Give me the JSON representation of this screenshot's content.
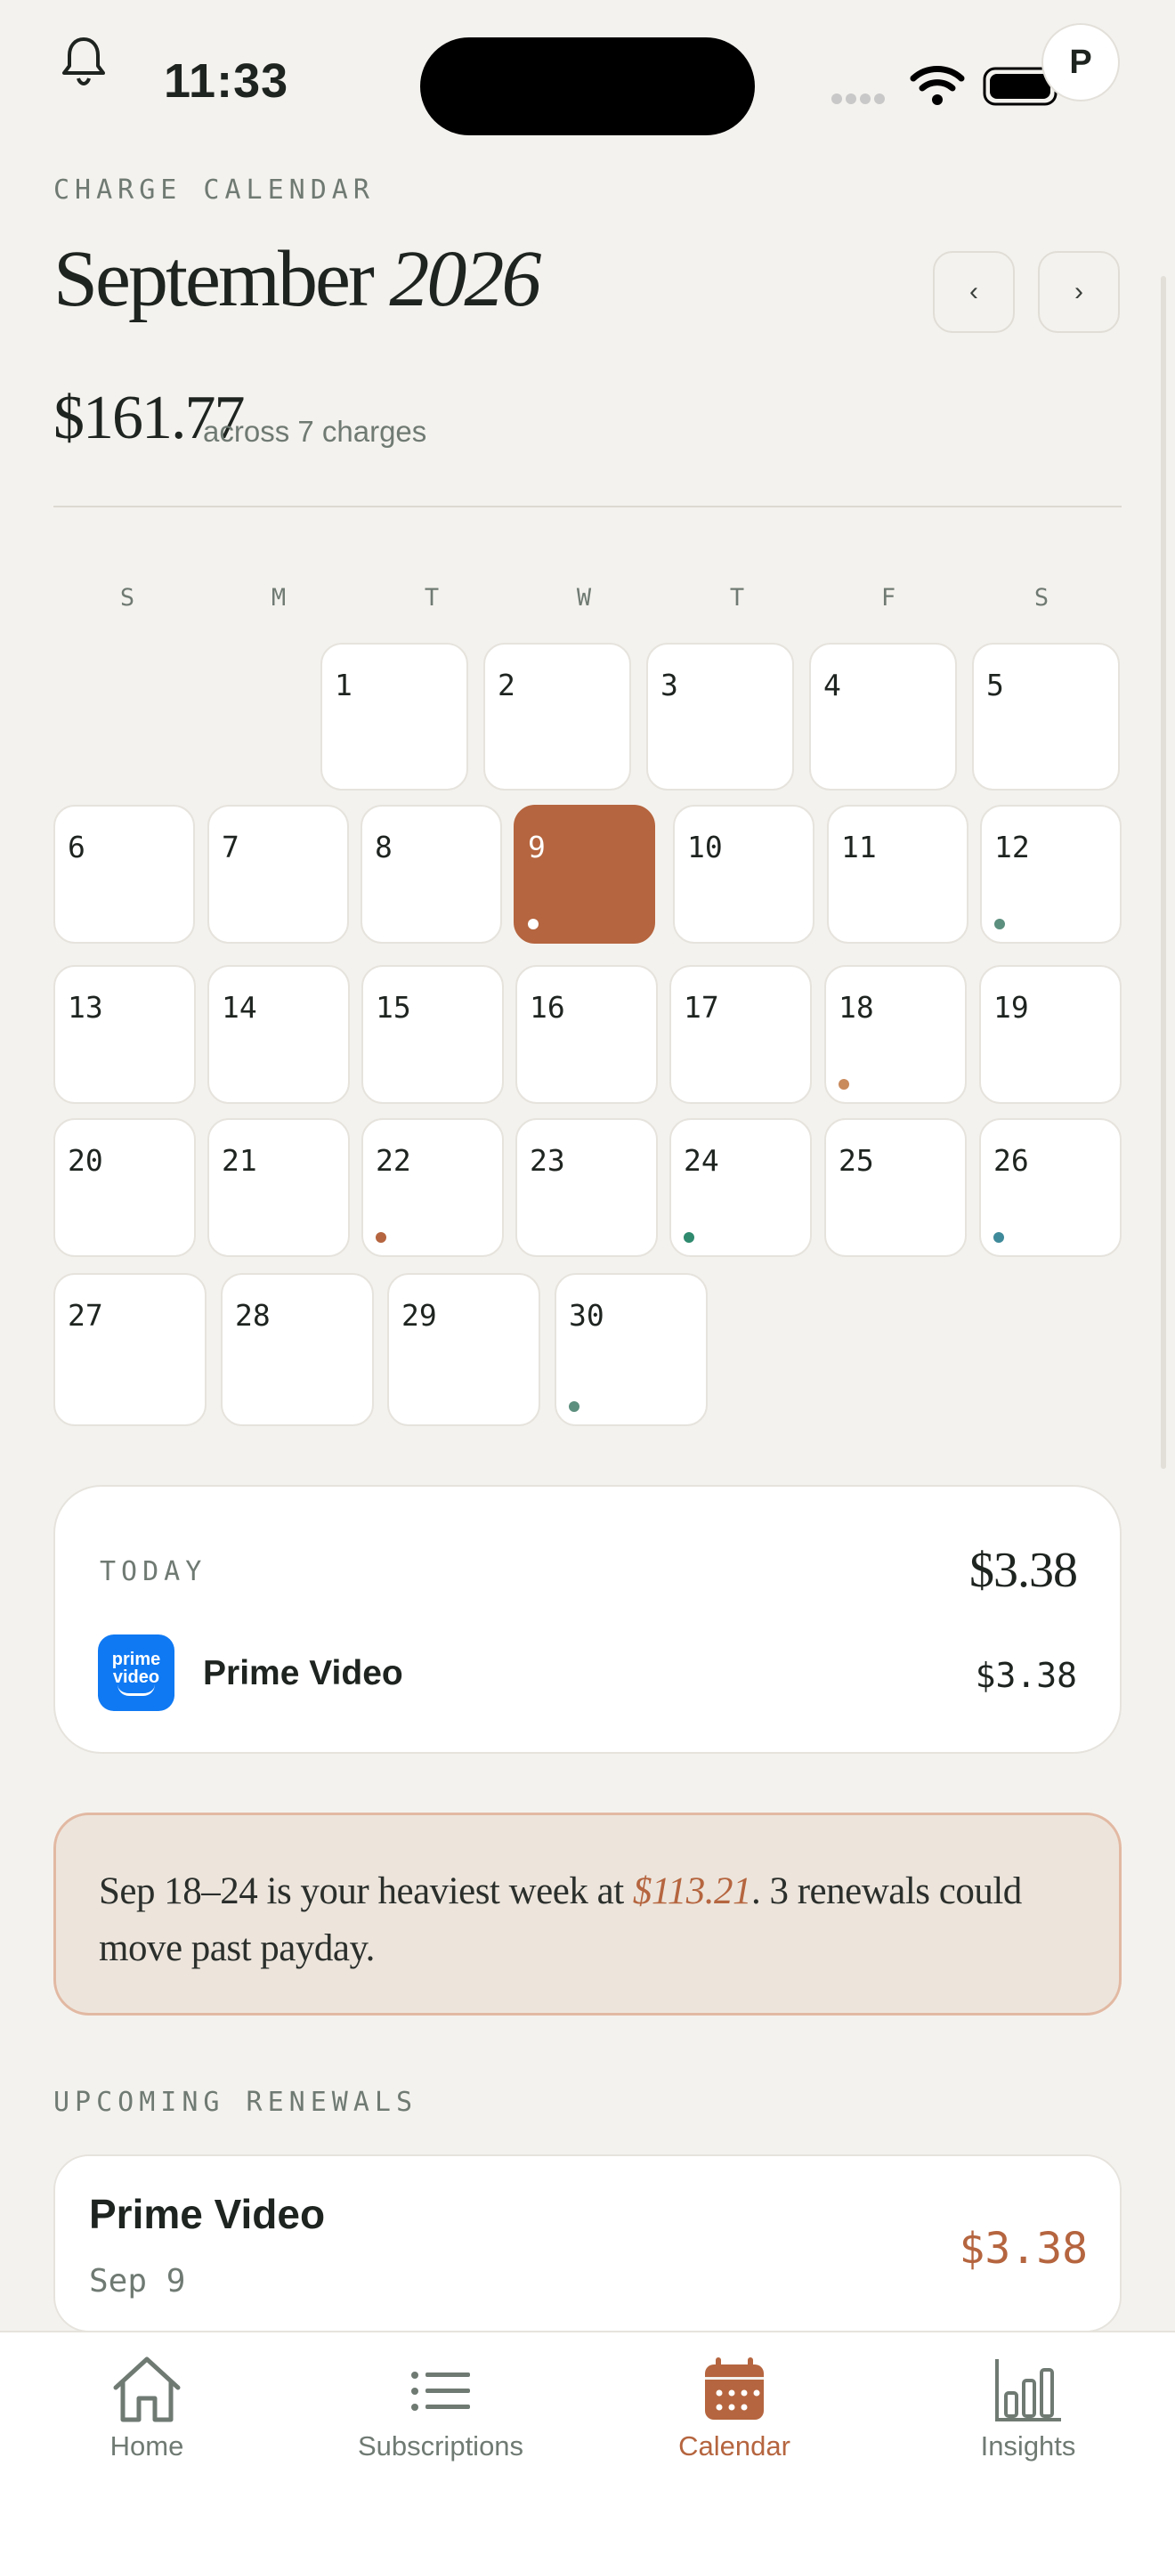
{
  "status": {
    "time": "11:33",
    "avatar_initial": "P"
  },
  "header": {
    "eyebrow": "CHARGE CALENDAR",
    "month": "September",
    "year": "2026",
    "prev_icon": "‹",
    "next_icon": "›",
    "total": "$161.77",
    "total_sub": "across 7 charges"
  },
  "calendar": {
    "weekdays": [
      "S",
      "M",
      "T",
      "W",
      "T",
      "F",
      "S"
    ],
    "today": 9,
    "days": [
      {
        "d": "1"
      },
      {
        "d": "2"
      },
      {
        "d": "3"
      },
      {
        "d": "4"
      },
      {
        "d": "5"
      },
      {
        "d": "6"
      },
      {
        "d": "7"
      },
      {
        "d": "8"
      },
      {
        "d": "9",
        "dot": "#ffffff"
      },
      {
        "d": "10"
      },
      {
        "d": "11"
      },
      {
        "d": "12",
        "dot": "#5c8f7e"
      },
      {
        "d": "13"
      },
      {
        "d": "14"
      },
      {
        "d": "15"
      },
      {
        "d": "16"
      },
      {
        "d": "17"
      },
      {
        "d": "18",
        "dot": "#c98a5c"
      },
      {
        "d": "19"
      },
      {
        "d": "20"
      },
      {
        "d": "21"
      },
      {
        "d": "22",
        "dot": "#b5653f"
      },
      {
        "d": "23"
      },
      {
        "d": "24",
        "dot": "#2f8a6e"
      },
      {
        "d": "25"
      },
      {
        "d": "26",
        "dot": "#3f8a9a"
      },
      {
        "d": "27"
      },
      {
        "d": "28"
      },
      {
        "d": "29"
      },
      {
        "d": "30",
        "dot": "#5c8f7e"
      }
    ]
  },
  "today_card": {
    "label": "TODAY",
    "total": "$3.38",
    "item_name": "Prime Video",
    "item_amount": "$3.38",
    "logo_line1": "prime",
    "logo_line2": "video"
  },
  "insight": {
    "before": "Sep 18–24 is your heaviest week at ",
    "highlight": "$113.21",
    "after": ". 3 renewals could move past payday."
  },
  "upcoming": {
    "label": "UPCOMING RENEWALS",
    "items": [
      {
        "name": "Prime Video",
        "date": "Sep 9",
        "amount": "$3.38"
      }
    ]
  },
  "tabs": [
    {
      "label": "Home",
      "icon": "home-icon"
    },
    {
      "label": "Subscriptions",
      "icon": "list-icon"
    },
    {
      "label": "Calendar",
      "icon": "calendar-icon",
      "active": true
    },
    {
      "label": "Insights",
      "icon": "bar-chart-icon"
    }
  ],
  "colors": {
    "accent": "#b5653f",
    "background": "#f4f2ee",
    "muted": "#6f7a73"
  }
}
